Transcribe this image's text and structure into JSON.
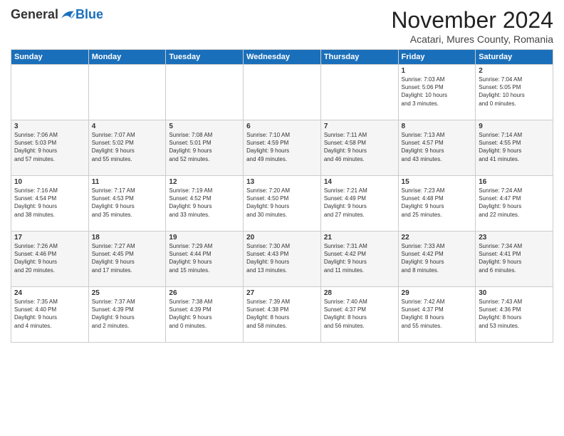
{
  "logo": {
    "general": "General",
    "blue": "Blue"
  },
  "title": "November 2024",
  "subtitle": "Acatari, Mures County, Romania",
  "headers": [
    "Sunday",
    "Monday",
    "Tuesday",
    "Wednesday",
    "Thursday",
    "Friday",
    "Saturday"
  ],
  "weeks": [
    [
      {
        "day": "",
        "info": ""
      },
      {
        "day": "",
        "info": ""
      },
      {
        "day": "",
        "info": ""
      },
      {
        "day": "",
        "info": ""
      },
      {
        "day": "",
        "info": ""
      },
      {
        "day": "1",
        "info": "Sunrise: 7:03 AM\nSunset: 5:06 PM\nDaylight: 10 hours\nand 3 minutes."
      },
      {
        "day": "2",
        "info": "Sunrise: 7:04 AM\nSunset: 5:05 PM\nDaylight: 10 hours\nand 0 minutes."
      }
    ],
    [
      {
        "day": "3",
        "info": "Sunrise: 7:06 AM\nSunset: 5:03 PM\nDaylight: 9 hours\nand 57 minutes."
      },
      {
        "day": "4",
        "info": "Sunrise: 7:07 AM\nSunset: 5:02 PM\nDaylight: 9 hours\nand 55 minutes."
      },
      {
        "day": "5",
        "info": "Sunrise: 7:08 AM\nSunset: 5:01 PM\nDaylight: 9 hours\nand 52 minutes."
      },
      {
        "day": "6",
        "info": "Sunrise: 7:10 AM\nSunset: 4:59 PM\nDaylight: 9 hours\nand 49 minutes."
      },
      {
        "day": "7",
        "info": "Sunrise: 7:11 AM\nSunset: 4:58 PM\nDaylight: 9 hours\nand 46 minutes."
      },
      {
        "day": "8",
        "info": "Sunrise: 7:13 AM\nSunset: 4:57 PM\nDaylight: 9 hours\nand 43 minutes."
      },
      {
        "day": "9",
        "info": "Sunrise: 7:14 AM\nSunset: 4:55 PM\nDaylight: 9 hours\nand 41 minutes."
      }
    ],
    [
      {
        "day": "10",
        "info": "Sunrise: 7:16 AM\nSunset: 4:54 PM\nDaylight: 9 hours\nand 38 minutes."
      },
      {
        "day": "11",
        "info": "Sunrise: 7:17 AM\nSunset: 4:53 PM\nDaylight: 9 hours\nand 35 minutes."
      },
      {
        "day": "12",
        "info": "Sunrise: 7:19 AM\nSunset: 4:52 PM\nDaylight: 9 hours\nand 33 minutes."
      },
      {
        "day": "13",
        "info": "Sunrise: 7:20 AM\nSunset: 4:50 PM\nDaylight: 9 hours\nand 30 minutes."
      },
      {
        "day": "14",
        "info": "Sunrise: 7:21 AM\nSunset: 4:49 PM\nDaylight: 9 hours\nand 27 minutes."
      },
      {
        "day": "15",
        "info": "Sunrise: 7:23 AM\nSunset: 4:48 PM\nDaylight: 9 hours\nand 25 minutes."
      },
      {
        "day": "16",
        "info": "Sunrise: 7:24 AM\nSunset: 4:47 PM\nDaylight: 9 hours\nand 22 minutes."
      }
    ],
    [
      {
        "day": "17",
        "info": "Sunrise: 7:26 AM\nSunset: 4:46 PM\nDaylight: 9 hours\nand 20 minutes."
      },
      {
        "day": "18",
        "info": "Sunrise: 7:27 AM\nSunset: 4:45 PM\nDaylight: 9 hours\nand 17 minutes."
      },
      {
        "day": "19",
        "info": "Sunrise: 7:29 AM\nSunset: 4:44 PM\nDaylight: 9 hours\nand 15 minutes."
      },
      {
        "day": "20",
        "info": "Sunrise: 7:30 AM\nSunset: 4:43 PM\nDaylight: 9 hours\nand 13 minutes."
      },
      {
        "day": "21",
        "info": "Sunrise: 7:31 AM\nSunset: 4:42 PM\nDaylight: 9 hours\nand 11 minutes."
      },
      {
        "day": "22",
        "info": "Sunrise: 7:33 AM\nSunset: 4:42 PM\nDaylight: 9 hours\nand 8 minutes."
      },
      {
        "day": "23",
        "info": "Sunrise: 7:34 AM\nSunset: 4:41 PM\nDaylight: 9 hours\nand 6 minutes."
      }
    ],
    [
      {
        "day": "24",
        "info": "Sunrise: 7:35 AM\nSunset: 4:40 PM\nDaylight: 9 hours\nand 4 minutes."
      },
      {
        "day": "25",
        "info": "Sunrise: 7:37 AM\nSunset: 4:39 PM\nDaylight: 9 hours\nand 2 minutes."
      },
      {
        "day": "26",
        "info": "Sunrise: 7:38 AM\nSunset: 4:39 PM\nDaylight: 9 hours\nand 0 minutes."
      },
      {
        "day": "27",
        "info": "Sunrise: 7:39 AM\nSunset: 4:38 PM\nDaylight: 8 hours\nand 58 minutes."
      },
      {
        "day": "28",
        "info": "Sunrise: 7:40 AM\nSunset: 4:37 PM\nDaylight: 8 hours\nand 56 minutes."
      },
      {
        "day": "29",
        "info": "Sunrise: 7:42 AM\nSunset: 4:37 PM\nDaylight: 8 hours\nand 55 minutes."
      },
      {
        "day": "30",
        "info": "Sunrise: 7:43 AM\nSunset: 4:36 PM\nDaylight: 8 hours\nand 53 minutes."
      }
    ]
  ]
}
